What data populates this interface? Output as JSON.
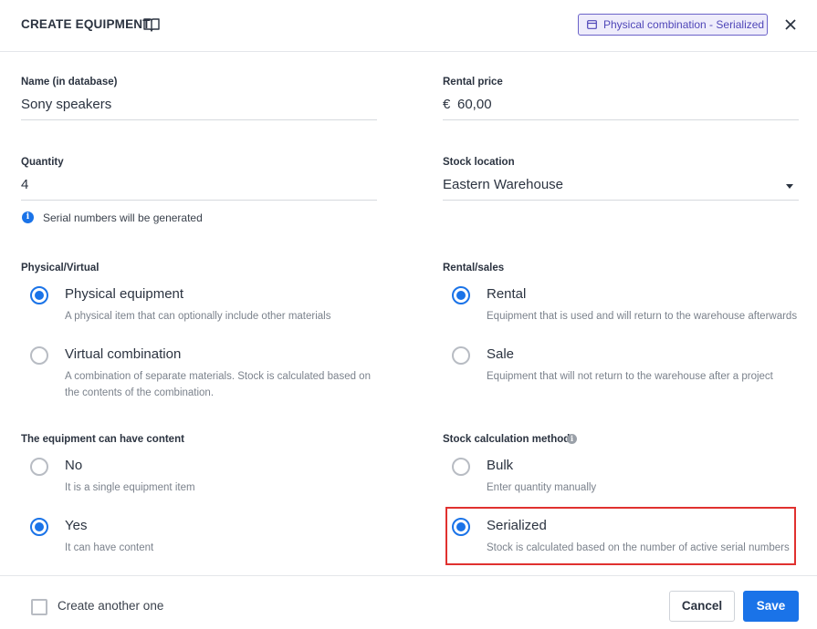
{
  "header": {
    "title": "CREATE EQUIPMENT",
    "badge": "Physical combination - Serialized"
  },
  "fields": {
    "name": {
      "label": "Name (in database)",
      "value": "Sony speakers"
    },
    "rental_price": {
      "label": "Rental price",
      "currency": "€",
      "value": "60,00"
    },
    "quantity": {
      "label": "Quantity",
      "value": "4"
    },
    "stock_location": {
      "label": "Stock location",
      "value": "Eastern Warehouse"
    },
    "serial_info": "Serial numbers will be generated"
  },
  "physical_virtual": {
    "label": "Physical/Virtual",
    "options": [
      {
        "label": "Physical equipment",
        "desc": "A physical item that can optionally include other materials",
        "checked": true
      },
      {
        "label": "Virtual combination",
        "desc": "A combination of separate materials. Stock is calculated based on the contents of the combination.",
        "checked": false
      }
    ]
  },
  "rental_sales": {
    "label": "Rental/sales",
    "options": [
      {
        "label": "Rental",
        "desc": "Equipment that is used and will return to the warehouse afterwards",
        "checked": true
      },
      {
        "label": "Sale",
        "desc": "Equipment that will not return to the warehouse after a project",
        "checked": false
      }
    ]
  },
  "content": {
    "label": "The equipment can have content",
    "options": [
      {
        "label": "No",
        "desc": "It is a single equipment item",
        "checked": false
      },
      {
        "label": "Yes",
        "desc": "It can have content",
        "checked": true
      }
    ]
  },
  "stock_method": {
    "label": "Stock calculation method",
    "options": [
      {
        "label": "Bulk",
        "desc": "Enter quantity manually",
        "checked": false
      },
      {
        "label": "Serialized",
        "desc": "Stock is calculated based on the number of active serial numbers",
        "checked": true
      }
    ]
  },
  "footer": {
    "create_another": "Create another one",
    "cancel": "Cancel",
    "save": "Save"
  },
  "colors": {
    "accent": "#1a73e8",
    "badge_border": "#6b63c9",
    "highlight": "#e0312f"
  }
}
